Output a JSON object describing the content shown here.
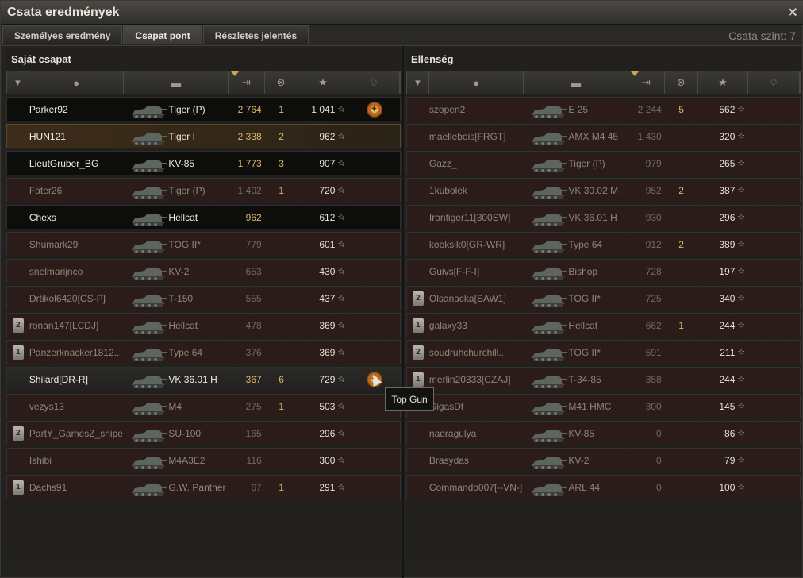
{
  "window": {
    "title": "Csata eredmények",
    "close_icon": "close-icon"
  },
  "tabs": [
    {
      "label": "Személyes eredmény",
      "active": false
    },
    {
      "label": "Csapat pont",
      "active": true
    },
    {
      "label": "Részletes jelentés",
      "active": false
    }
  ],
  "battle_tier": "Csata szint: 7",
  "header_icons": [
    "badge-icon",
    "player-icon",
    "tank-icon",
    "xp-icon",
    "kills-icon",
    "star-icon",
    "medal-icon"
  ],
  "teams": {
    "left": {
      "title": "Saját csapat",
      "rows": [
        {
          "badge": "",
          "name": "Parker92",
          "tank": "Tiger (P)",
          "xp": "2 764",
          "kills": "1",
          "score": "1 041",
          "medal": true,
          "alive": true,
          "selected": false
        },
        {
          "badge": "",
          "name": "HUN121",
          "tank": "Tiger I",
          "xp": "2 338",
          "kills": "2",
          "score": "962",
          "medal": false,
          "alive": true,
          "selected": true
        },
        {
          "badge": "",
          "name": "LieutGruber_BG",
          "tank": "KV-85",
          "xp": "1 773",
          "kills": "3",
          "score": "907",
          "medal": false,
          "alive": true,
          "selected": false
        },
        {
          "badge": "",
          "name": "Fater26",
          "tank": "Tiger (P)",
          "xp": "1 402",
          "kills": "1",
          "score": "720",
          "medal": false,
          "alive": false,
          "selected": false
        },
        {
          "badge": "",
          "name": "Chexs",
          "tank": "Hellcat",
          "xp": "962",
          "kills": "",
          "score": "612",
          "medal": false,
          "alive": true,
          "selected": false
        },
        {
          "badge": "",
          "name": "Shumark29",
          "tank": "TOG II*",
          "xp": "779",
          "kills": "",
          "score": "601",
          "medal": false,
          "alive": false,
          "selected": false
        },
        {
          "badge": "",
          "name": "snelmarijnco",
          "tank": "KV-2",
          "xp": "653",
          "kills": "",
          "score": "430",
          "medal": false,
          "alive": false,
          "selected": false
        },
        {
          "badge": "",
          "name": "Drtikol6420[CS-P]",
          "tank": "T-150",
          "xp": "555",
          "kills": "",
          "score": "437",
          "medal": false,
          "alive": false,
          "selected": false
        },
        {
          "badge": "2",
          "name": "ronan147[LCDJ]",
          "tank": "Hellcat",
          "xp": "478",
          "kills": "",
          "score": "369",
          "medal": false,
          "alive": false,
          "selected": false
        },
        {
          "badge": "1",
          "name": "Panzerknacker1812..",
          "tank": "Type 64",
          "xp": "376",
          "kills": "",
          "score": "369",
          "medal": false,
          "alive": false,
          "selected": false
        },
        {
          "badge": "",
          "name": "Shilard[DR-R]",
          "tank": "VK 36.01 H",
          "xp": "367",
          "kills": "6",
          "score": "729",
          "medal": true,
          "alive": true,
          "selected": false,
          "hover": true
        },
        {
          "badge": "",
          "name": "vezys13",
          "tank": "M4",
          "xp": "275",
          "kills": "1",
          "score": "503",
          "medal": false,
          "alive": false,
          "selected": false
        },
        {
          "badge": "2",
          "name": "PartY_GamesZ_snipe..",
          "tank": "SU-100",
          "xp": "165",
          "kills": "",
          "score": "296",
          "medal": false,
          "alive": false,
          "selected": false
        },
        {
          "badge": "",
          "name": "Ishibi",
          "tank": "M4A3E2",
          "xp": "116",
          "kills": "",
          "score": "300",
          "medal": false,
          "alive": false,
          "selected": false
        },
        {
          "badge": "1",
          "name": "Dachs91",
          "tank": "G.W. Panther",
          "xp": "67",
          "kills": "1",
          "score": "291",
          "medal": false,
          "alive": false,
          "selected": false
        }
      ]
    },
    "right": {
      "title": "Ellenség",
      "rows": [
        {
          "badge": "",
          "name": "szopen2",
          "tank": "E 25",
          "xp": "2 244",
          "kills": "5",
          "score": "562",
          "medal": false,
          "alive": false
        },
        {
          "badge": "",
          "name": "maellebois[FRGT]",
          "tank": "AMX M4 45",
          "xp": "1 430",
          "kills": "",
          "score": "320",
          "medal": false,
          "alive": false
        },
        {
          "badge": "",
          "name": "Gazz_",
          "tank": "Tiger (P)",
          "xp": "979",
          "kills": "",
          "score": "265",
          "medal": false,
          "alive": false
        },
        {
          "badge": "",
          "name": "1kubolek",
          "tank": "VK 30.02 M",
          "xp": "952",
          "kills": "2",
          "score": "387",
          "medal": false,
          "alive": false
        },
        {
          "badge": "",
          "name": "Irontiger11[300SW]",
          "tank": "VK 36.01 H",
          "xp": "930",
          "kills": "",
          "score": "296",
          "medal": false,
          "alive": false
        },
        {
          "badge": "",
          "name": "kooksik0[GR-WR]",
          "tank": "Type 64",
          "xp": "912",
          "kills": "2",
          "score": "389",
          "medal": false,
          "alive": false
        },
        {
          "badge": "",
          "name": "Guivs[F-F-I]",
          "tank": "Bishop",
          "xp": "728",
          "kills": "",
          "score": "197",
          "medal": false,
          "alive": false
        },
        {
          "badge": "2",
          "name": "Olsanacka[SAW1]",
          "tank": "TOG II*",
          "xp": "725",
          "kills": "",
          "score": "340",
          "medal": false,
          "alive": false
        },
        {
          "badge": "1",
          "name": "galaxy33",
          "tank": "Hellcat",
          "xp": "662",
          "kills": "1",
          "score": "244",
          "medal": false,
          "alive": false
        },
        {
          "badge": "2",
          "name": "soudruhchurchill..",
          "tank": "TOG II*",
          "xp": "591",
          "kills": "",
          "score": "211",
          "medal": false,
          "alive": false
        },
        {
          "badge": "1",
          "name": "merlin20333[CZAJ]",
          "tank": "T-34-85",
          "xp": "358",
          "kills": "",
          "score": "244",
          "medal": false,
          "alive": false
        },
        {
          "badge": "",
          "name": "GigasDt",
          "tank": "M41 HMC",
          "xp": "300",
          "kills": "",
          "score": "145",
          "medal": false,
          "alive": false
        },
        {
          "badge": "",
          "name": "nadragulya",
          "tank": "KV-85",
          "xp": "0",
          "kills": "",
          "score": "86",
          "medal": false,
          "alive": false
        },
        {
          "badge": "",
          "name": "Brasydas",
          "tank": "KV-2",
          "xp": "0",
          "kills": "",
          "score": "79",
          "medal": false,
          "alive": false
        },
        {
          "badge": "",
          "name": "Commando007[--VN-]",
          "tank": "ARL 44",
          "xp": "0",
          "kills": "",
          "score": "100",
          "medal": false,
          "alive": false
        }
      ]
    }
  },
  "tooltip": "Top Gun",
  "star_glyph": "☆"
}
